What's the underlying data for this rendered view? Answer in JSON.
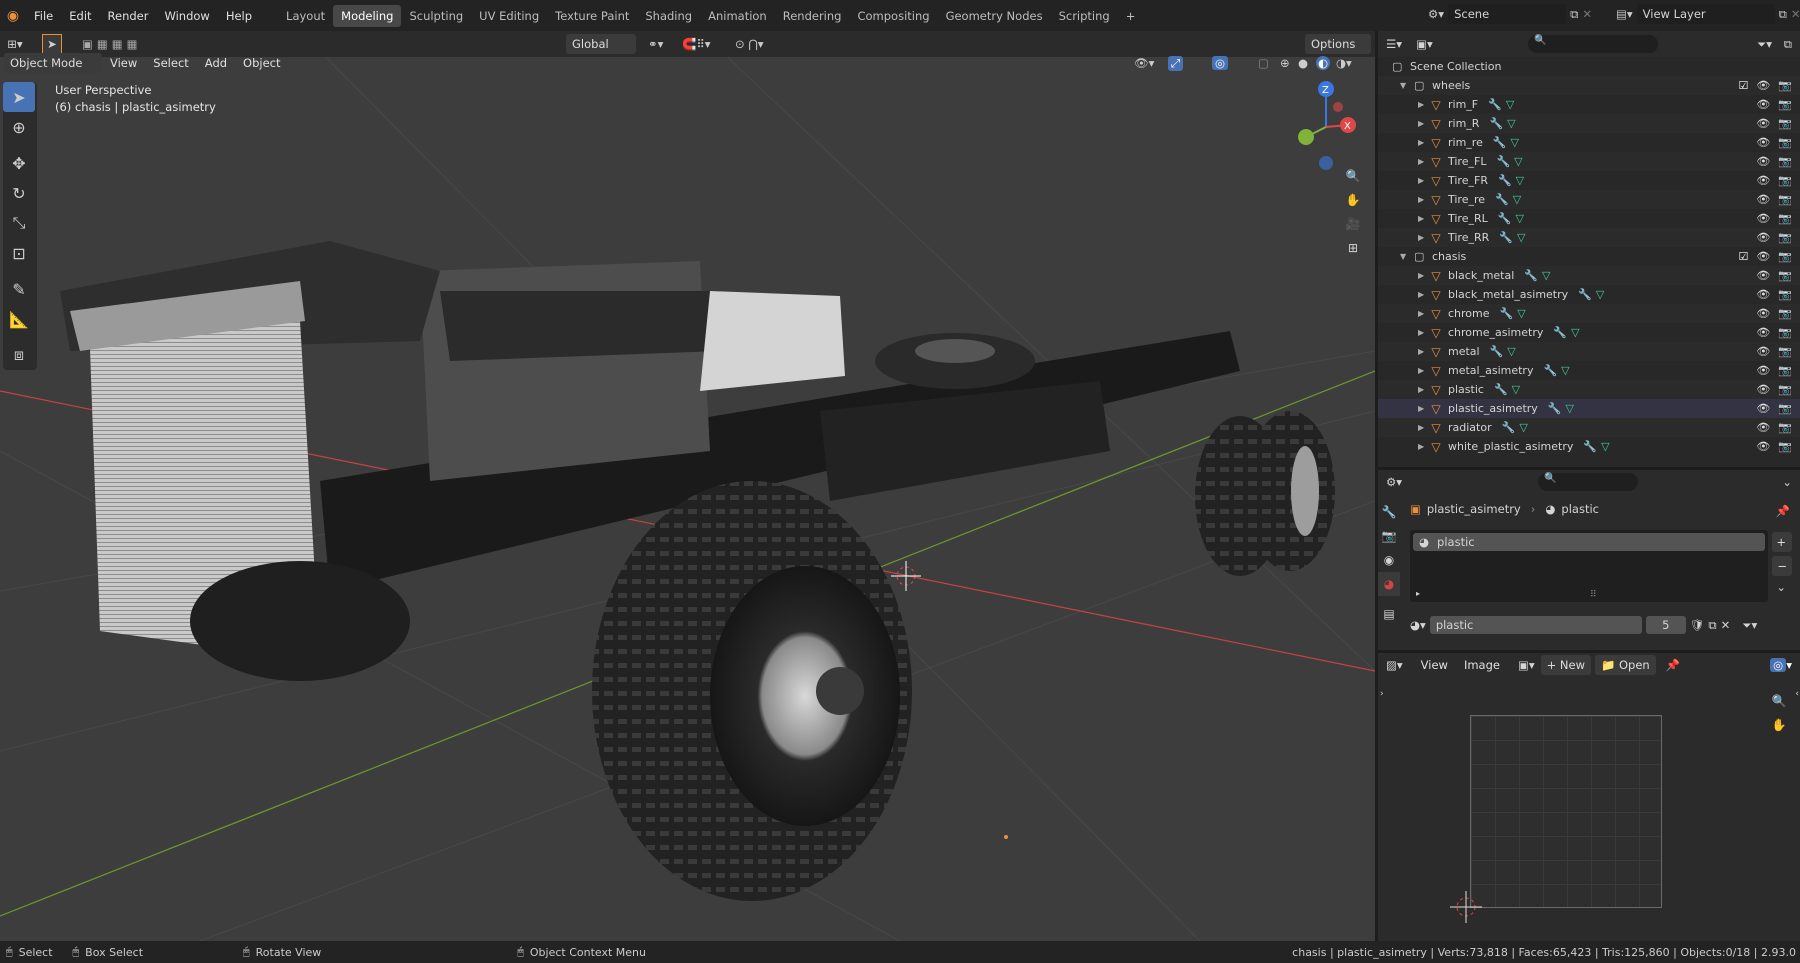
{
  "topbar": {
    "menus": [
      "File",
      "Edit",
      "Render",
      "Window",
      "Help"
    ],
    "workspaces": [
      "Layout",
      "Modeling",
      "Sculpting",
      "UV Editing",
      "Texture Paint",
      "Shading",
      "Animation",
      "Rendering",
      "Compositing",
      "Geometry Nodes",
      "Scripting"
    ],
    "active_workspace": "Modeling",
    "scene": "Scene",
    "view_layer": "View Layer"
  },
  "toolheader": {
    "orientation": "Global",
    "options": "Options"
  },
  "viewport_header": {
    "mode": "Object Mode",
    "menus": [
      "View",
      "Select",
      "Add",
      "Object"
    ]
  },
  "viewport": {
    "perspective": "User Perspective",
    "context": "(6) chasis | plastic_asimetry",
    "colors": {
      "x_axis": "#e04848",
      "y_axis": "#7fb33a",
      "z_axis": "#3a78e0",
      "bg": "#3d3d3d"
    }
  },
  "outliner": {
    "root": "Scene Collection",
    "collections": [
      {
        "name": "wheels",
        "objects": [
          "rim_F",
          "rim_R",
          "rim_re",
          "Tire_FL",
          "Tire_FR",
          "Tire_re",
          "Tire_RL",
          "Tire_RR"
        ]
      },
      {
        "name": "chasis",
        "objects": [
          "black_metal",
          "black_metal_asimetry",
          "chrome",
          "chrome_asimetry",
          "metal",
          "metal_asimetry",
          "plastic",
          "plastic_asimetry",
          "radiator",
          "white_plastic_asimetry"
        ]
      }
    ]
  },
  "properties": {
    "object": "plastic_asimetry",
    "material": "plastic",
    "slot": "plastic",
    "material_field": "plastic",
    "users": "5"
  },
  "image_editor": {
    "menus": [
      "View",
      "Image"
    ],
    "new": "New",
    "open": "Open"
  },
  "statusbar": {
    "select": "Select",
    "box_select": "Box Select",
    "rotate": "Rotate View",
    "context_menu": "Object Context Menu",
    "stats": "chasis | plastic_asimetry | Verts:73,818 | Faces:65,423 | Tris:125,860 | Objects:0/18 | 2.93.0"
  }
}
